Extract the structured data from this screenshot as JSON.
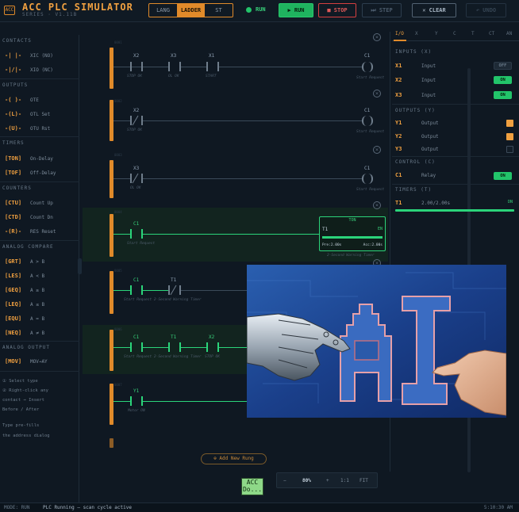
{
  "header": {
    "logo_text": "ACC",
    "title": "ACC PLC SIMULATOR",
    "subtitle": "SERIES · V1.11B",
    "mode_tabs": [
      "LANG",
      "LADDER",
      "ST"
    ],
    "run_indicator": "RUN",
    "buttons": {
      "run": "▶ RUN",
      "stop": "■ STOP",
      "step": "⏭ STEP",
      "clear": "✕ CLEAR",
      "undo": "↶ UNDO"
    }
  },
  "sidebar": {
    "contacts_title": "CONTACTS",
    "contacts": [
      {
        "sym": "-| |-",
        "label": "XIC (NO)"
      },
      {
        "sym": "-|/|-",
        "label": "XIO (NC)"
      }
    ],
    "outputs_title": "OUTPUTS",
    "outputs": [
      {
        "sym": "-( )-",
        "label": "OTE"
      },
      {
        "sym": "-(L)-",
        "label": "OTL Set"
      },
      {
        "sym": "-(U)-",
        "label": "OTU Rst"
      }
    ],
    "timers_title": "TIMERS",
    "timers": [
      {
        "sym": "[TON]",
        "label": "On-Delay"
      },
      {
        "sym": "[TOF]",
        "label": "Off-Delay"
      }
    ],
    "counters_title": "COUNTERS",
    "counters": [
      {
        "sym": "[CTU]",
        "label": "Count Up"
      },
      {
        "sym": "[CTD]",
        "label": "Count Dn"
      },
      {
        "sym": "-(R)-",
        "label": "RES Reset"
      }
    ],
    "compare_title": "ANALOG COMPARE",
    "compare": [
      {
        "sym": "[GRT]",
        "label": "A > B"
      },
      {
        "sym": "[LES]",
        "label": "A < B"
      },
      {
        "sym": "[GEQ]",
        "label": "A ≥ B"
      },
      {
        "sym": "[LEQ]",
        "label": "A ≤ B"
      },
      {
        "sym": "[EQU]",
        "label": "A = B"
      },
      {
        "sym": "[NEQ]",
        "label": "A ≠ B"
      }
    ],
    "analog_out_title": "ANALOG OUTPUT",
    "analog_out": [
      {
        "sym": "[MOV]",
        "label": "MOV→AY"
      }
    ],
    "hints": [
      "① Select type",
      "② Right-click any",
      "   contact → Insert",
      "   Before / After",
      "Type pre-fills",
      "the address dialog"
    ]
  },
  "rungs": [
    {
      "num": "0001",
      "contacts": [
        {
          "addr": "X2",
          "desc": "STOP OK"
        },
        {
          "addr": "X3",
          "desc": "OL OK"
        },
        {
          "addr": "X1",
          "desc": "START"
        }
      ],
      "coil": {
        "addr": "C1",
        "desc": "Start Request"
      }
    },
    {
      "num": "0002",
      "contacts": [
        {
          "addr": "X2",
          "desc": "STOP OK"
        }
      ],
      "coil": {
        "addr": "C1",
        "desc": "Start Request"
      }
    },
    {
      "num": "0003",
      "contacts": [
        {
          "addr": "X3",
          "desc": "OL OK"
        }
      ],
      "coil": {
        "addr": "C1",
        "desc": "Start Request"
      }
    },
    {
      "num": "0004",
      "contacts": [
        {
          "addr": "C1",
          "desc": "Start Request"
        }
      ],
      "timer": {
        "type": "TON",
        "addr": "T1",
        "state": "EN",
        "pre": "Pre:2.00s",
        "acc": "Acc:2.00s",
        "desc": "2-Second Warning Timer"
      }
    },
    {
      "num": "0005",
      "contacts": [
        {
          "addr": "C1",
          "desc": ""
        },
        {
          "addr": "T1",
          "desc": ""
        }
      ],
      "desc": "Start Request 2-Second Warning Timer"
    },
    {
      "num": "0006",
      "contacts": [
        {
          "addr": "C1",
          "desc": ""
        },
        {
          "addr": "T1",
          "desc": ""
        },
        {
          "addr": "X2",
          "desc": "STOP OK"
        }
      ],
      "desc": "Start Request 2-Second Warning Timer"
    },
    {
      "num": "0007",
      "contacts": [
        {
          "addr": "Y1",
          "desc": "Motor ON"
        }
      ]
    }
  ],
  "canvas": {
    "add_rung": "⊕ Add New Rung",
    "zoom": {
      "minus": "−",
      "value": "80%",
      "plus": "+",
      "ratio": "1:1",
      "fit": "FIT"
    }
  },
  "right_panel": {
    "tabs": [
      "I/O",
      "X",
      "Y",
      "C",
      "T",
      "CT",
      "AN"
    ],
    "inputs_title": "INPUTS (X)",
    "inputs": [
      {
        "id": "X1",
        "name": "Input",
        "state": "OFF"
      },
      {
        "id": "X2",
        "name": "Input",
        "state": "ON"
      },
      {
        "id": "X3",
        "name": "Input",
        "state": "ON"
      }
    ],
    "outputs_title": "OUTPUTS (Y)",
    "outputs": [
      {
        "id": "Y1",
        "name": "Output"
      },
      {
        "id": "Y2",
        "name": "Output"
      },
      {
        "id": "Y3",
        "name": "Output"
      }
    ],
    "control_title": "CONTROL (C)",
    "control": [
      {
        "id": "C1",
        "name": "Relay",
        "state": "ON"
      }
    ],
    "timers_title": "TIMERS (T)",
    "timers": [
      {
        "id": "T1",
        "value": "2.00/2.00s",
        "state": "DN"
      }
    ]
  },
  "mini_logo": "ACC Do...",
  "status": {
    "mode": "MODE: RUN",
    "message": "PLC Running — scan cycle active",
    "time": "5:10:30 AM"
  },
  "colors": {
    "accent": "#e08a2a",
    "energized": "#2bd47a",
    "stop": "#d64040",
    "background": "#0f1822"
  }
}
